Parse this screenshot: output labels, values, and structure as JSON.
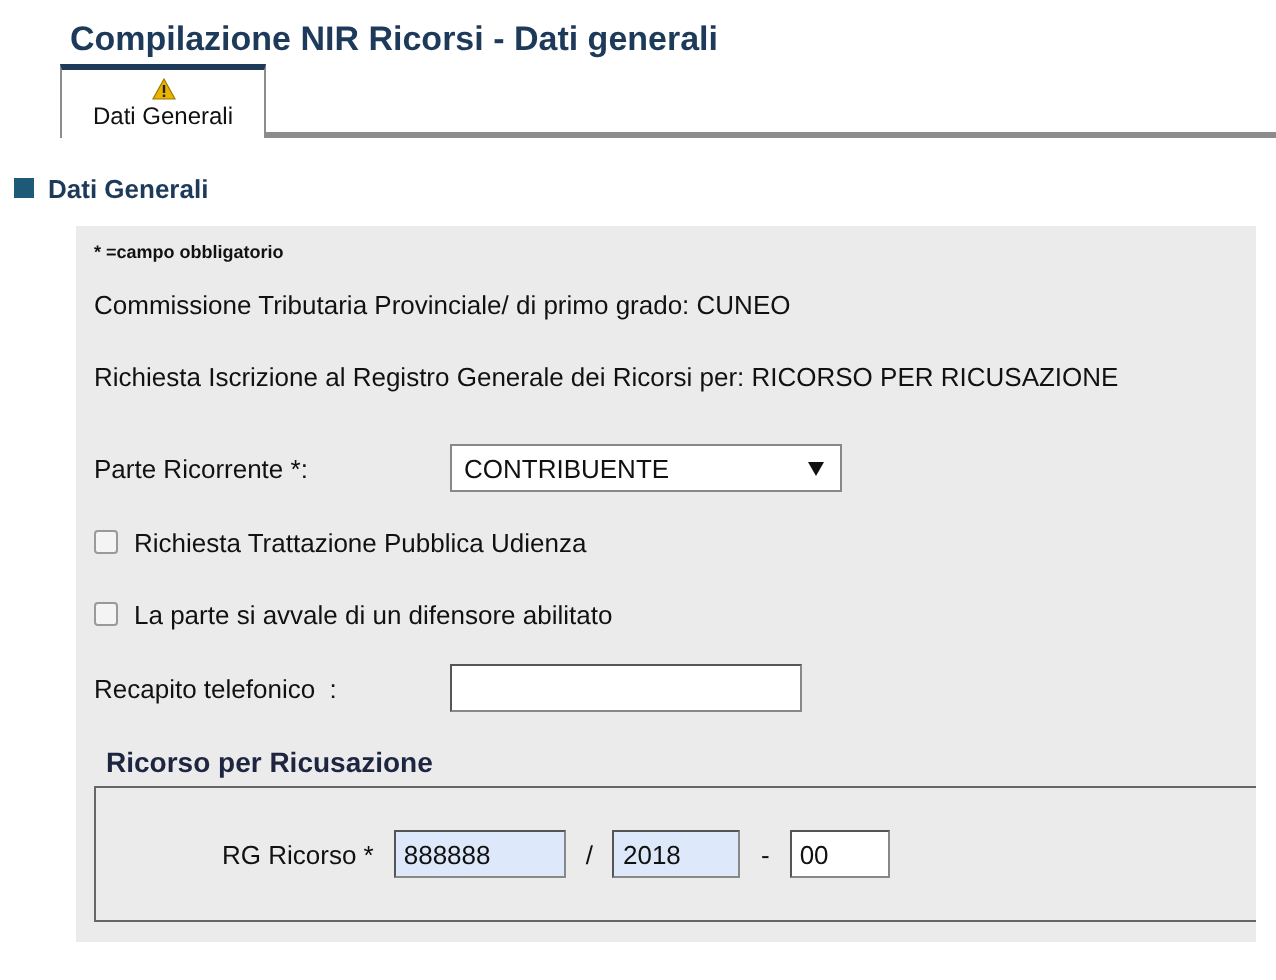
{
  "page_title": "Compilazione NIR Ricorsi - Dati generali",
  "tabs": [
    {
      "label": "Dati Generali",
      "selected": true,
      "warning": true
    }
  ],
  "section": {
    "title": "Dati Generali"
  },
  "form": {
    "note": "* =campo obbligatorio",
    "info_lines": [
      "Commissione Tributaria Provinciale/ di primo grado: CUNEO",
      "Richiesta Iscrizione al Registro Generale dei Ricorsi per: RICORSO PER RICUSAZIONE"
    ],
    "parte_ricorrente": {
      "label": "Parte Ricorrente *:",
      "value": "CONTRIBUENTE"
    },
    "checkboxes": [
      {
        "label": "Richiesta Trattazione Pubblica Udienza",
        "checked": false
      },
      {
        "label": "La parte si avvale di un difensore abilitato",
        "checked": false
      }
    ],
    "recapito": {
      "label": "Recapito telefonico  :"
    },
    "subsection": {
      "title": "Ricorso per Ricusazione",
      "label": "RG Ricorso *",
      "fields": [
        {
          "value": "888888",
          "highlighted": true
        },
        {
          "separator": "/",
          "value": "2018",
          "highlighted": true
        },
        {
          "separator": "-",
          "value": "00",
          "highlighted": false
        }
      ]
    }
  }
}
